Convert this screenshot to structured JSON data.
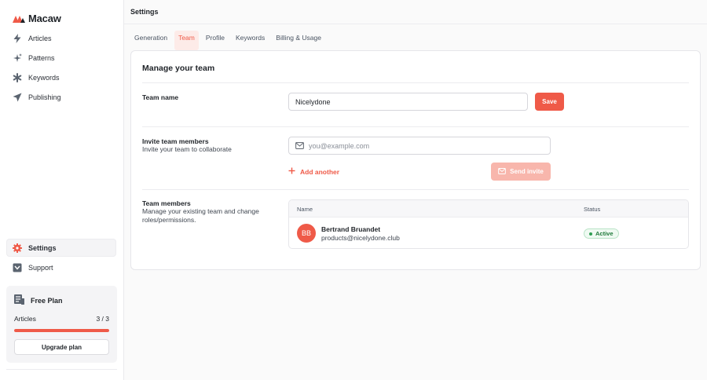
{
  "app": {
    "brand": "Macaw"
  },
  "sidebar": {
    "items": [
      {
        "label": "Articles",
        "icon": "bolt-icon"
      },
      {
        "label": "Patterns",
        "icon": "sparkles-icon"
      },
      {
        "label": "Keywords",
        "icon": "asterisk-icon"
      },
      {
        "label": "Publishing",
        "icon": "paper-plane-icon"
      }
    ],
    "bottom_items": [
      {
        "label": "Settings",
        "icon": "gear-icon",
        "active": true
      },
      {
        "label": "Support",
        "icon": "support-icon"
      }
    ],
    "plan": {
      "title": "Free Plan",
      "metric_label": "Articles",
      "metric_value": "3 / 3",
      "progress": 1.0,
      "upgrade_label": "Upgrade plan"
    }
  },
  "header": {
    "title": "Settings"
  },
  "tabs": [
    {
      "label": "Generation"
    },
    {
      "label": "Team",
      "active": true
    },
    {
      "label": "Profile"
    },
    {
      "label": "Keywords"
    },
    {
      "label": "Billing & Usage"
    }
  ],
  "team": {
    "title": "Manage your team",
    "name_label": "Team name",
    "name_value": "Nicelydone",
    "save_label": "Save",
    "invite_label": "Invite team members",
    "invite_sub": "Invite your team to collaborate",
    "invite_placeholder": "you@example.com",
    "add_another_label": "Add another",
    "send_invite_label": "Send invite",
    "members_label": "Team members",
    "members_sub": "Manage your existing team and change roles/permissions.",
    "columns": [
      "Name",
      "Status"
    ],
    "members": [
      {
        "initials": "BB",
        "name": "Bertrand Bruandet",
        "email": "products@nicelydone.club",
        "status": "Active"
      }
    ]
  },
  "colors": {
    "accent": "#ef5a48",
    "accent_light": "#f8b6ac",
    "success": "#2e9e53"
  }
}
